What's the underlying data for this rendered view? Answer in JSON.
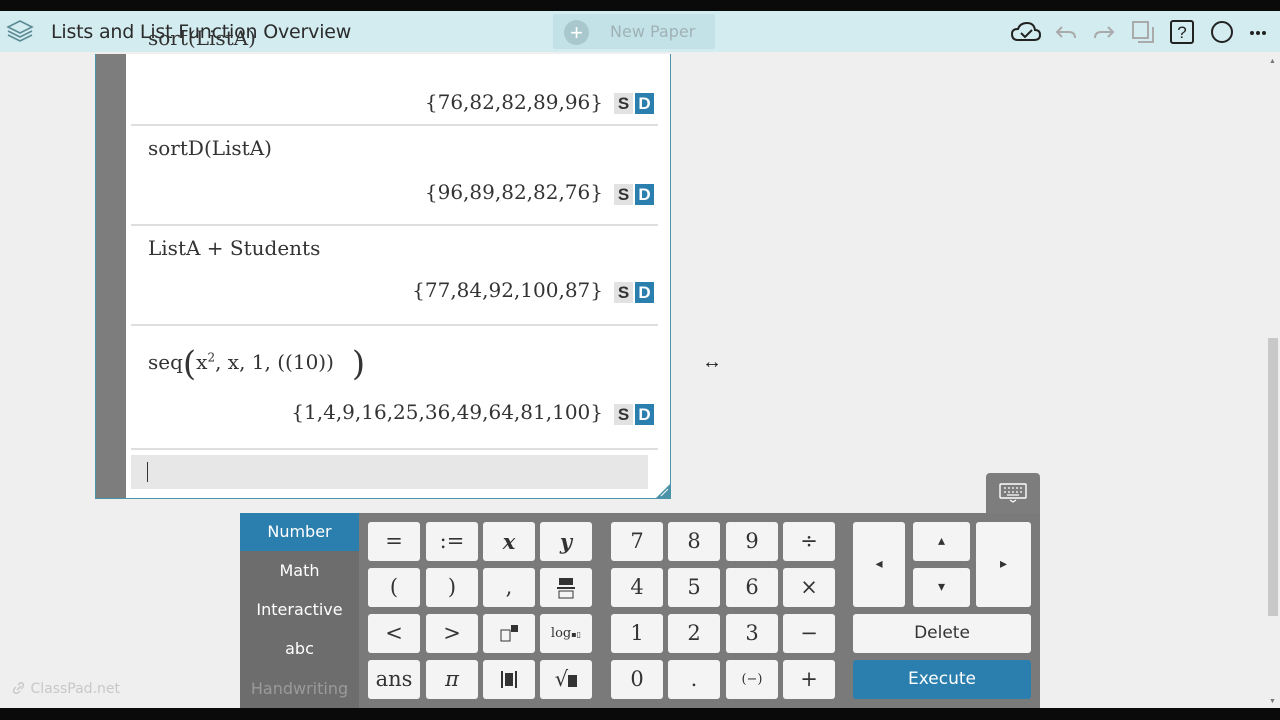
{
  "header": {
    "title": "Lists and List Function Overview",
    "new_paper_label": "New Paper"
  },
  "entries": [
    {
      "expr": "sort(ListA)",
      "result": "{76,82,82,89,96}"
    },
    {
      "expr": "sortD(ListA)",
      "result": "{96,89,82,82,76}"
    },
    {
      "expr": "ListA + Students",
      "result": "{77,84,92,100,87}"
    },
    {
      "expr_parts": {
        "fn": "seq",
        "x": "x",
        "sup": "2",
        "rest": ", x, 1, ((10))"
      },
      "result": "{1,4,9,16,25,36,49,64,81,100}"
    }
  ],
  "badge": {
    "s": "S",
    "d": "D"
  },
  "keyboard": {
    "tabs": [
      "Number",
      "Math",
      "Interactive",
      "abc",
      "Handwriting"
    ],
    "keys": {
      "eq": "=",
      "assign": ":=",
      "x": "x",
      "y": "y",
      "lparen": "(",
      "rparen": ")",
      "comma": ",",
      "lt": "<",
      "gt": ">",
      "log": "log",
      "ans": "ans",
      "pi": "π",
      "sqrt": "√",
      "n7": "7",
      "n8": "8",
      "n9": "9",
      "div": "÷",
      "n4": "4",
      "n5": "5",
      "n6": "6",
      "mul": "×",
      "n1": "1",
      "n2": "2",
      "n3": "3",
      "minus": "−",
      "n0": "0",
      "dot": ".",
      "neg": "(−)",
      "plus": "+",
      "left": "◂",
      "up": "▴",
      "right": "▸",
      "down": "▾",
      "delete": "Delete",
      "execute": "Execute"
    }
  },
  "watermark": "ClassPad.net",
  "colors": {
    "accent": "#2b7fae",
    "header_bg": "#d3ecf0"
  }
}
